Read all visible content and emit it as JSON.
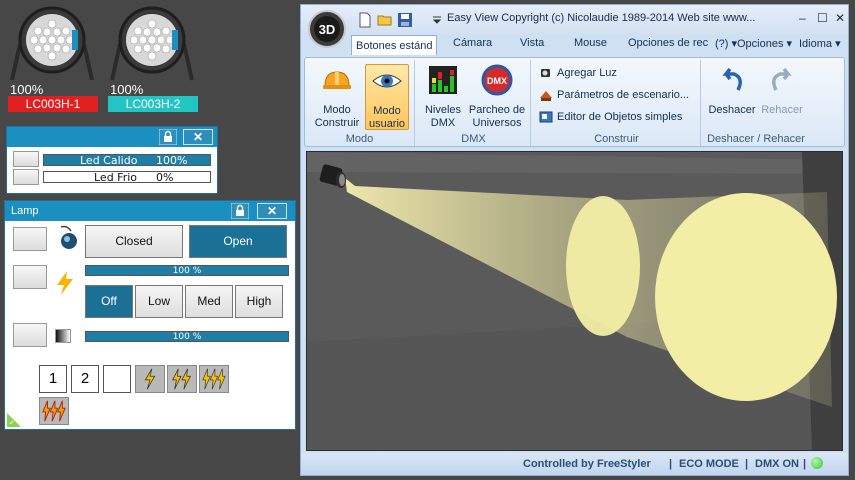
{
  "fixtures": [
    {
      "percent": "100%",
      "name": "LC003H-1",
      "tag_color": "#e02020"
    },
    {
      "percent": "100%",
      "name": "LC003H-2",
      "tag_color": "#22c4c4"
    }
  ],
  "led_window": {
    "rows": [
      {
        "label": "Led Calido",
        "value": "100%",
        "level": 1.0
      },
      {
        "label": "Led Frio",
        "value": "0%",
        "level": 0.0
      }
    ]
  },
  "lamp_window": {
    "title": "Lamp",
    "shutter": {
      "closed_label": "Closed",
      "open_label": "Open",
      "selected": "Open"
    },
    "strobe_level": {
      "text": "100 %",
      "level": 1.0
    },
    "power": {
      "options": [
        "Off",
        "Low",
        "Med",
        "High"
      ],
      "selected": "Off"
    },
    "dimmer_level": {
      "text": "100 %",
      "level": 1.0
    },
    "presets": [
      "1",
      "2"
    ]
  },
  "main_window": {
    "title": "Easy View   Copyright (c) Nicolaudie 1989-2014   Web site www...",
    "tabs": [
      "Botones estánd",
      "Cámara",
      "Vista",
      "Mouse",
      "Opciones de rec"
    ],
    "right_menus": [
      "(?)",
      "Opciones",
      "Idioma"
    ],
    "ribbon": {
      "modo": {
        "label": "Modo",
        "buttons": [
          {
            "line1": "Modo",
            "line2": "Construir"
          },
          {
            "line1": "Modo",
            "line2": "usuario",
            "active": true
          }
        ]
      },
      "dmx": {
        "label": "DMX",
        "buttons": [
          {
            "line1": "Niveles",
            "line2": "DMX"
          },
          {
            "line1": "Parcheo de",
            "line2": "Universos"
          }
        ]
      },
      "construir": {
        "label": "Construir",
        "commands": [
          "Agregar Luz",
          "Parámetros de escenario...",
          "Editor de Objetos simples"
        ]
      },
      "deshacer": {
        "label": "Deshacer / Rehacer",
        "buttons": [
          {
            "label": "Deshacer"
          },
          {
            "label": "Rehacer",
            "disabled": true
          }
        ]
      }
    },
    "status": {
      "controlled": "Controlled by FreeStyler",
      "eco": "ECO MODE",
      "dmx": "DMX ON",
      "dmx_led_color": "#3ac43a"
    }
  },
  "colors": {
    "accent": "#1b8fc0",
    "background": "#474747",
    "beam": "#f3eea6"
  }
}
